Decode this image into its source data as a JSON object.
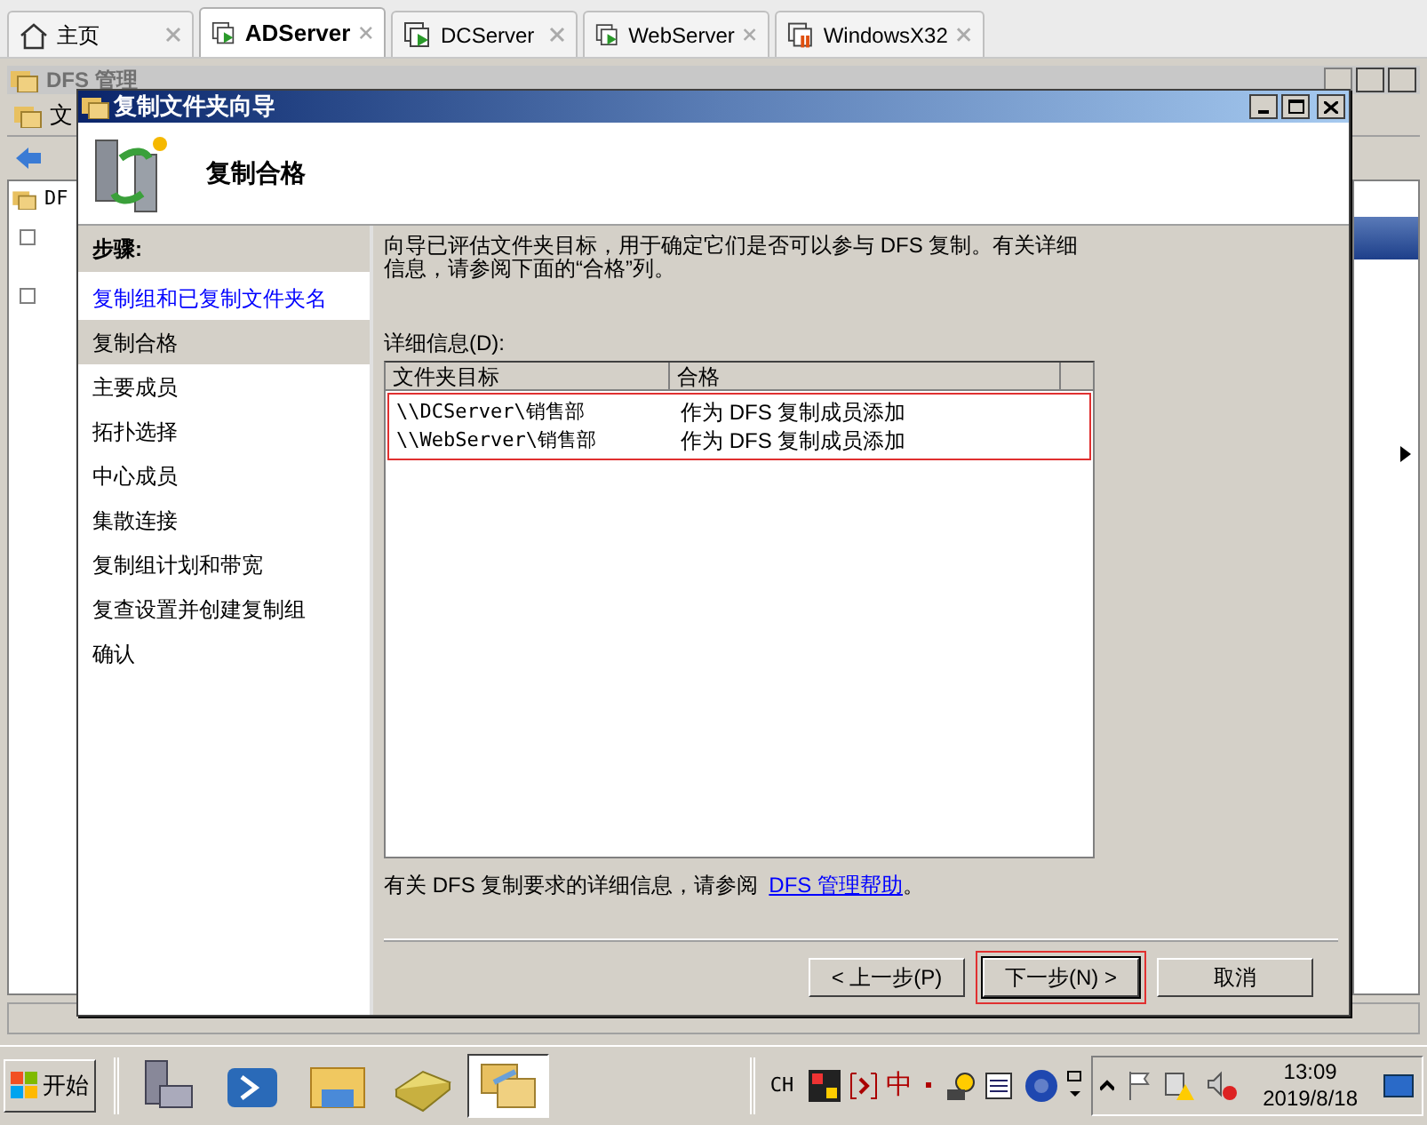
{
  "browser_tabs": [
    {
      "label": "主页",
      "selected": false,
      "kind": "home"
    },
    {
      "label": "ADServer",
      "selected": true,
      "kind": "running"
    },
    {
      "label": "DCServer",
      "selected": false,
      "kind": "running"
    },
    {
      "label": "WebServer",
      "selected": false,
      "kind": "running"
    },
    {
      "label": "WindowsX32",
      "selected": false,
      "kind": "paused"
    }
  ],
  "background_window": {
    "title": "DFS 管理",
    "menu": "文",
    "tree_item": "DF"
  },
  "dialog": {
    "title": "复制文件夹向导",
    "header": "复制合格",
    "steps_heading": "步骤:",
    "steps": [
      {
        "label": "复制组和已复制文件夹名",
        "selected": false,
        "completed": true
      },
      {
        "label": "复制合格",
        "selected": true,
        "completed": false
      },
      {
        "label": "主要成员",
        "selected": false,
        "completed": false
      },
      {
        "label": "拓扑选择",
        "selected": false,
        "completed": false
      },
      {
        "label": "中心成员",
        "selected": false,
        "completed": false
      },
      {
        "label": "集散连接",
        "selected": false,
        "completed": false
      },
      {
        "label": "复制组计划和带宽",
        "selected": false,
        "completed": false
      },
      {
        "label": "复查设置并创建复制组",
        "selected": false,
        "completed": false
      },
      {
        "label": "确认",
        "selected": false,
        "completed": false
      }
    ],
    "description": "向导已评估文件夹目标，用于确定它们是否可以参与 DFS 复制。有关详细信息，请参阅下面的“合格”列。",
    "details_label": "详细信息(D):",
    "columns": [
      "文件夹目标",
      "合格"
    ],
    "rows_highlighted": true,
    "rows": [
      {
        "target": "\\\\DCServer\\销售部",
        "eligibility": "作为 DFS 复制成员添加"
      },
      {
        "target": "\\\\WebServer\\销售部",
        "eligibility": "作为 DFS 复制成员添加"
      }
    ],
    "footer_text": "有关 DFS 复制要求的详细信息，请参阅",
    "footer_link": "DFS 管理帮助",
    "footer_end": "。",
    "buttons": [
      {
        "label": "< 上一步(P)",
        "default": false,
        "highlighted": false
      },
      {
        "label": "下一步(N) >",
        "default": true,
        "highlighted": true
      },
      {
        "label": "取消",
        "default": false,
        "highlighted": false
      }
    ]
  },
  "taskbar": {
    "start": "开始",
    "apps": [
      {
        "kind": "server",
        "selected": false
      },
      {
        "kind": "shell",
        "selected": false
      },
      {
        "kind": "folder",
        "selected": false
      },
      {
        "kind": "scanner",
        "selected": false
      },
      {
        "kind": "dfs",
        "selected": true
      }
    ],
    "language": "CH",
    "ime": "中",
    "time": "13:09",
    "date": "2019/8/18"
  }
}
